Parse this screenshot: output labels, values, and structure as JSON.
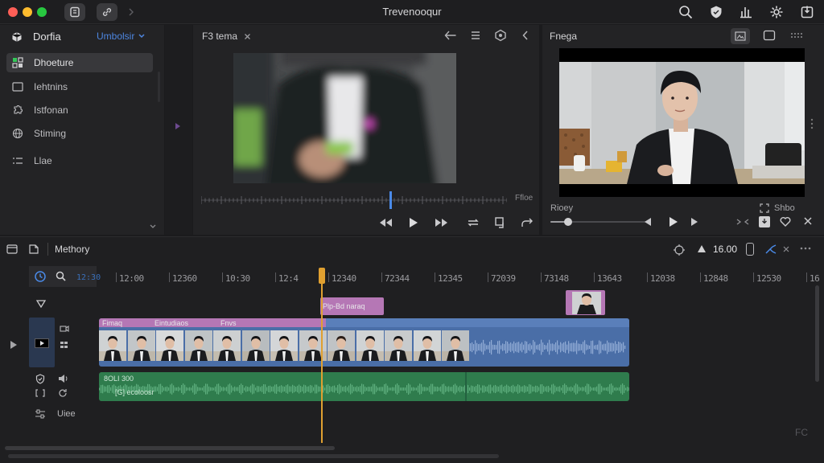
{
  "titlebar": {
    "title": "Trevenooqur",
    "traffic_colors": [
      "#ff5f57",
      "#febc2e",
      "#28c840"
    ],
    "left_buttons": [
      "document-icon",
      "link-icon"
    ],
    "right_icons": [
      "search-icon",
      "shield-icon",
      "share-icon",
      "gear-icon",
      "export-icon"
    ]
  },
  "sidebar": {
    "title": "Dorfia",
    "dropdown": "Umbolsir",
    "items": [
      {
        "label": "Dhoeture",
        "icon": "grid-icon",
        "selected": true
      },
      {
        "label": "Iehtnins",
        "icon": "folder-icon",
        "selected": false
      },
      {
        "label": "Istfonan",
        "icon": "puzzle-icon",
        "selected": false
      },
      {
        "label": "Stiming",
        "icon": "globe-icon",
        "selected": false
      },
      {
        "label": "Llae",
        "icon": "list-icon",
        "selected": false
      }
    ]
  },
  "viewer": {
    "tab_label": "F3 tema",
    "scrub_label": "Ffloe"
  },
  "preview": {
    "title": "Fnega",
    "left_label": "Rioey",
    "right_label": "Shbo"
  },
  "timeline": {
    "title": "Methory",
    "timecode_left": "12:30",
    "duration": "16.00",
    "ticks": [
      "12:00",
      "12360",
      "10:30",
      "12:4",
      "12340",
      "72344",
      "12345",
      "72039",
      "73148",
      "13643",
      "12038",
      "12848",
      "12530",
      "16"
    ],
    "playhead_fraction": 0.36,
    "title_clip": "Plp-Bd naraq",
    "main_clip_labels": [
      "Fimaq",
      "Eintudiaos",
      "Fnvs"
    ],
    "audio_labels": [
      "8OLI 300",
      "[G] ecoloosr"
    ],
    "track_label": "Uiee",
    "accent_color": "#3a74d8",
    "clip_pink": "#b577b5",
    "clip_blue": "#4a6ea7",
    "clip_green": "#2f7c4d"
  }
}
